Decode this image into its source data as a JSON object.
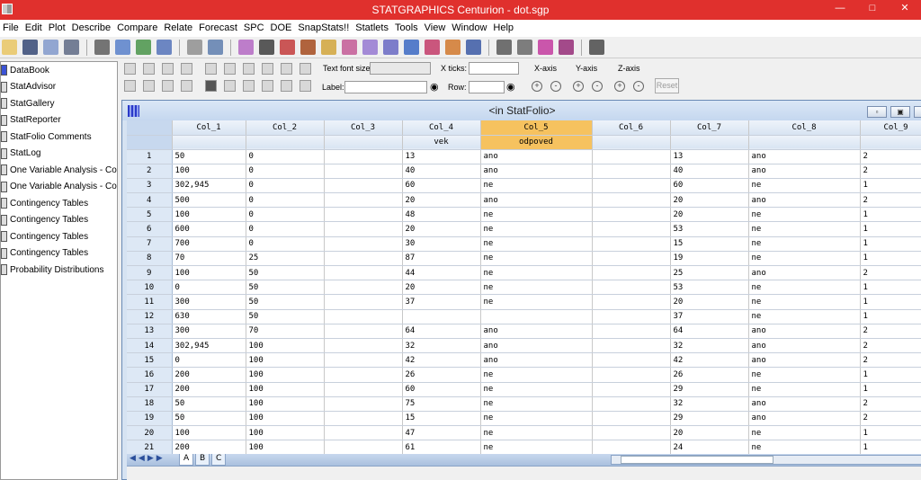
{
  "app": {
    "title": "STATGRAPHICS Centurion - dot.sgp",
    "accent": "#e0302d"
  },
  "menu": [
    "File",
    "Edit",
    "Plot",
    "Describe",
    "Compare",
    "Relate",
    "Forecast",
    "SPC",
    "DOE",
    "SnapStats!!",
    "Statlets",
    "Tools",
    "View",
    "Window",
    "Help"
  ],
  "toolbar_icons": [
    "open-icon",
    "save-icon",
    "datasheet-icon",
    "save-data-icon",
    "cut-icon",
    "copy-icon",
    "paste-icon",
    "undo-icon",
    "print-icon",
    "print-preview-icon",
    "scatterplot-icon",
    "table-icon",
    "analysis-icon",
    "house-icon",
    "chart-icon",
    "histogram-icon",
    "plot-icon",
    "bars-icon",
    "area-icon",
    "target-icon",
    "trend-icon",
    "bar-chart-icon",
    "tool-icon",
    "wizard-icon",
    "advisor-icon",
    "book-icon",
    "calculator-icon"
  ],
  "left_panel": [
    "DataBook",
    "StatAdvisor",
    "StatGallery",
    "StatReporter",
    "StatFolio Comments",
    "StatLog",
    "One Variable Analysis - Col_2",
    "One Variable Analysis - Col_2",
    "Contingency Tables",
    "Contingency Tables",
    "Contingency Tables",
    "Contingency Tables",
    "Probability Distributions"
  ],
  "tb2": {
    "text_font_size": "Text font size:",
    "x_ticks": "X ticks:",
    "label": "Label:",
    "row": "Row:",
    "x_axis": "X-axis",
    "y_axis": "Y-axis",
    "z_axis": "Z-axis",
    "reset": "Reset"
  },
  "window": {
    "title": "<in StatFolio>",
    "selected_column": "Col_5",
    "selected_color": "#f6c25f"
  },
  "columns": [
    "Col_1",
    "Col_2",
    "Col_3",
    "Col_4",
    "Col_5",
    "Col_6",
    "Col_7",
    "Col_8",
    "Col_9"
  ],
  "column_names": [
    "",
    "",
    "",
    "vek",
    "odpoved",
    "",
    "",
    "",
    ""
  ],
  "rows": [
    [
      "50",
      "0",
      "",
      "13",
      "ano",
      "",
      "13",
      "ano",
      "2"
    ],
    [
      "100",
      "0",
      "",
      "40",
      "ano",
      "",
      "40",
      "ano",
      "2"
    ],
    [
      "302,945",
      "0",
      "",
      "60",
      "ne",
      "",
      "60",
      "ne",
      "1"
    ],
    [
      "500",
      "0",
      "",
      "20",
      "ano",
      "",
      "20",
      "ano",
      "2"
    ],
    [
      "100",
      "0",
      "",
      "48",
      "ne",
      "",
      "20",
      "ne",
      "1"
    ],
    [
      "600",
      "0",
      "",
      "20",
      "ne",
      "",
      "53",
      "ne",
      "1"
    ],
    [
      "700",
      "0",
      "",
      "30",
      "ne",
      "",
      "15",
      "ne",
      "1"
    ],
    [
      "70",
      "25",
      "",
      "87",
      "ne",
      "",
      "19",
      "ne",
      "1"
    ],
    [
      "100",
      "50",
      "",
      "44",
      "ne",
      "",
      "25",
      "ano",
      "2"
    ],
    [
      "0",
      "50",
      "",
      "20",
      "ne",
      "",
      "53",
      "ne",
      "1"
    ],
    [
      "300",
      "50",
      "",
      "37",
      "ne",
      "",
      "20",
      "ne",
      "1"
    ],
    [
      "630",
      "50",
      "",
      "",
      "",
      "",
      "37",
      "ne",
      "1"
    ],
    [
      "300",
      "70",
      "",
      "64",
      "ano",
      "",
      "64",
      "ano",
      "2"
    ],
    [
      "302,945",
      "100",
      "",
      "32",
      "ano",
      "",
      "32",
      "ano",
      "2"
    ],
    [
      "0",
      "100",
      "",
      "42",
      "ano",
      "",
      "42",
      "ano",
      "2"
    ],
    [
      "200",
      "100",
      "",
      "26",
      "ne",
      "",
      "26",
      "ne",
      "1"
    ],
    [
      "200",
      "100",
      "",
      "60",
      "ne",
      "",
      "29",
      "ne",
      "1"
    ],
    [
      "50",
      "100",
      "",
      "75",
      "ne",
      "",
      "32",
      "ano",
      "2"
    ],
    [
      "50",
      "100",
      "",
      "15",
      "ne",
      "",
      "29",
      "ano",
      "2"
    ],
    [
      "100",
      "100",
      "",
      "47",
      "ne",
      "",
      "20",
      "ne",
      "1"
    ],
    [
      "200",
      "100",
      "",
      "61",
      "ne",
      "",
      "24",
      "ne",
      "1"
    ]
  ],
  "sheet_tabs": [
    "A",
    "B",
    "C"
  ]
}
